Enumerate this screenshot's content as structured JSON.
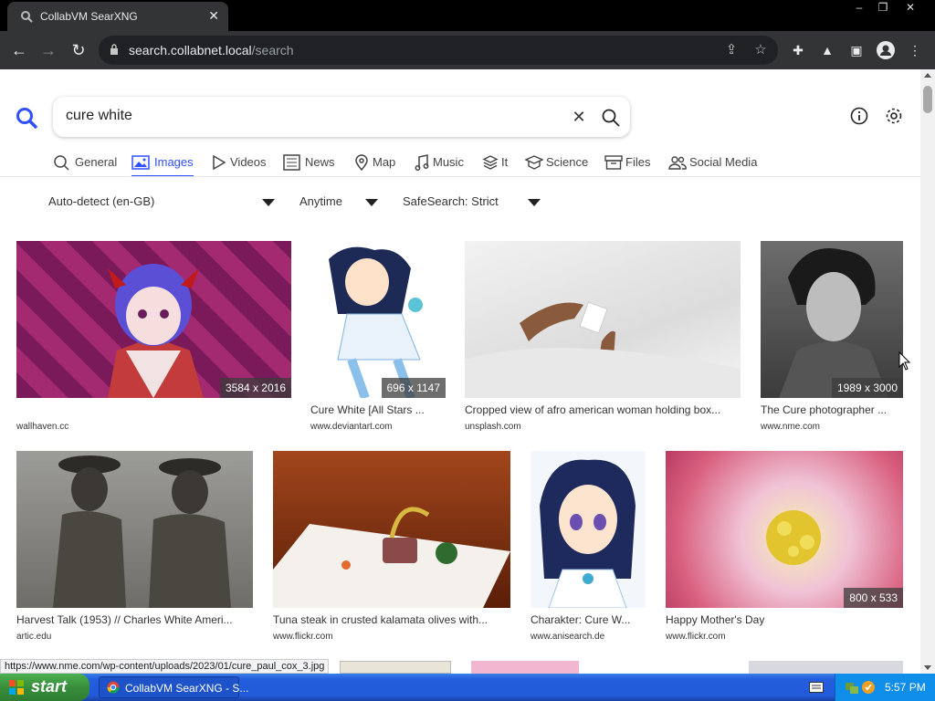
{
  "browser": {
    "tab_title": "CollabVM SearXNG",
    "url_host": "search.collabnet.local",
    "url_path": "/search"
  },
  "search": {
    "query": "cure white",
    "categories": [
      {
        "label": "General",
        "icon": "search-icon"
      },
      {
        "label": "Images",
        "icon": "image-icon",
        "active": true
      },
      {
        "label": "Videos",
        "icon": "play-icon"
      },
      {
        "label": "News",
        "icon": "newspaper-icon"
      },
      {
        "label": "Map",
        "icon": "map-pin-icon"
      },
      {
        "label": "Music",
        "icon": "music-icon"
      },
      {
        "label": "It",
        "icon": "layers-icon"
      },
      {
        "label": "Science",
        "icon": "graduation-icon"
      },
      {
        "label": "Files",
        "icon": "archive-icon"
      },
      {
        "label": "Social Media",
        "icon": "people-icon"
      }
    ],
    "filters": {
      "language": "Auto-detect (en-GB)",
      "time": "Anytime",
      "safesearch": "SafeSearch: Strict"
    }
  },
  "results": [
    {
      "title": "",
      "source": "wallhaven.cc",
      "resolution": "3584 x 2016"
    },
    {
      "title": "Cure White [All Stars ...",
      "source": "www.deviantart.com",
      "resolution": "696 x 1147"
    },
    {
      "title": "Cropped view of afro american woman holding box...",
      "source": "unsplash.com",
      "resolution": ""
    },
    {
      "title": "The Cure photographer ...",
      "source": "www.nme.com",
      "resolution": "1989 x 3000"
    },
    {
      "title": "Harvest Talk (1953) // Charles White Ameri...",
      "source": "artic.edu",
      "resolution": ""
    },
    {
      "title": "Tuna steak in crusted kalamata olives with...",
      "source": "www.flickr.com",
      "resolution": ""
    },
    {
      "title": "Charakter: Cure W...",
      "source": "www.anisearch.de",
      "resolution": ""
    },
    {
      "title": "Happy Mother's Day",
      "source": "www.flickr.com",
      "resolution": "800 x 533"
    }
  ],
  "status_url": "https://www.nme.com/wp-content/uploads/2023/01/cure_paul_cox_3.jpg",
  "taskbar": {
    "start_label": "start",
    "window_label": "CollabVM SearXNG - S...",
    "clock": "5:57 PM"
  },
  "colors": {
    "accent": "#3050ff",
    "chrome_bg": "#333436",
    "taskbar": "#245edc"
  }
}
